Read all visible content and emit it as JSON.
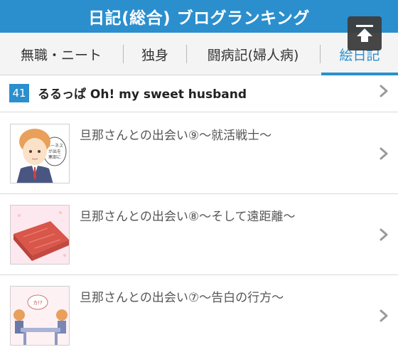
{
  "header": {
    "title": "日記(総合)  ブログランキング"
  },
  "tabs": [
    {
      "label": "無職・ニート",
      "active": false
    },
    {
      "label": "独身",
      "active": false
    },
    {
      "label": "闘病記(婦人病)",
      "active": false
    },
    {
      "label": "絵日記",
      "active": true
    }
  ],
  "scroll_top_icon": "arrow-up-to-top-icon",
  "ranking": {
    "rank": "41",
    "blog_title": "るるっぱ Oh! my sweet husband"
  },
  "entries": [
    {
      "title": "旦那さんとの出会い⑨〜就活戦士〜",
      "thumb_icon": "illustration-man-in-suit"
    },
    {
      "title": "旦那さんとの出会い⑧〜そして遠距離〜",
      "thumb_icon": "illustration-pink-blanket"
    },
    {
      "title": "旦那さんとの出会い⑦〜告白の行方〜",
      "thumb_icon": "illustration-couple-at-table"
    }
  ],
  "colors": {
    "accent": "#2b8fce",
    "header_bg": "#2b8fce",
    "tab_bar_bg": "#f4f4f4"
  }
}
